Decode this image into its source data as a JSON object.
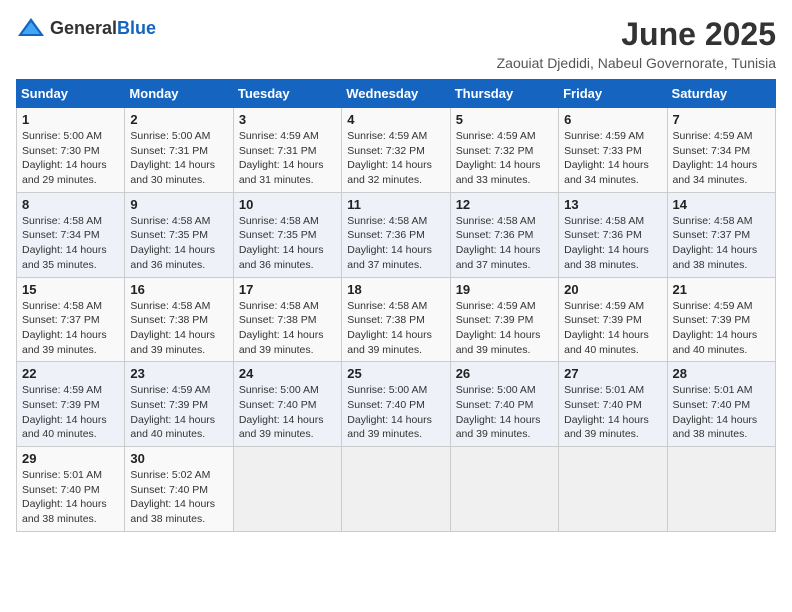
{
  "header": {
    "logo_general": "General",
    "logo_blue": "Blue",
    "month_year": "June 2025",
    "location": "Zaouiat Djedidi, Nabeul Governorate, Tunisia"
  },
  "weekdays": [
    "Sunday",
    "Monday",
    "Tuesday",
    "Wednesday",
    "Thursday",
    "Friday",
    "Saturday"
  ],
  "weeks": [
    [
      {
        "day": "1",
        "sunrise": "5:00 AM",
        "sunset": "7:30 PM",
        "daylight": "14 hours and 29 minutes."
      },
      {
        "day": "2",
        "sunrise": "5:00 AM",
        "sunset": "7:31 PM",
        "daylight": "14 hours and 30 minutes."
      },
      {
        "day": "3",
        "sunrise": "4:59 AM",
        "sunset": "7:31 PM",
        "daylight": "14 hours and 31 minutes."
      },
      {
        "day": "4",
        "sunrise": "4:59 AM",
        "sunset": "7:32 PM",
        "daylight": "14 hours and 32 minutes."
      },
      {
        "day": "5",
        "sunrise": "4:59 AM",
        "sunset": "7:32 PM",
        "daylight": "14 hours and 33 minutes."
      },
      {
        "day": "6",
        "sunrise": "4:59 AM",
        "sunset": "7:33 PM",
        "daylight": "14 hours and 34 minutes."
      },
      {
        "day": "7",
        "sunrise": "4:59 AM",
        "sunset": "7:34 PM",
        "daylight": "14 hours and 34 minutes."
      }
    ],
    [
      {
        "day": "8",
        "sunrise": "4:58 AM",
        "sunset": "7:34 PM",
        "daylight": "14 hours and 35 minutes."
      },
      {
        "day": "9",
        "sunrise": "4:58 AM",
        "sunset": "7:35 PM",
        "daylight": "14 hours and 36 minutes."
      },
      {
        "day": "10",
        "sunrise": "4:58 AM",
        "sunset": "7:35 PM",
        "daylight": "14 hours and 36 minutes."
      },
      {
        "day": "11",
        "sunrise": "4:58 AM",
        "sunset": "7:36 PM",
        "daylight": "14 hours and 37 minutes."
      },
      {
        "day": "12",
        "sunrise": "4:58 AM",
        "sunset": "7:36 PM",
        "daylight": "14 hours and 37 minutes."
      },
      {
        "day": "13",
        "sunrise": "4:58 AM",
        "sunset": "7:36 PM",
        "daylight": "14 hours and 38 minutes."
      },
      {
        "day": "14",
        "sunrise": "4:58 AM",
        "sunset": "7:37 PM",
        "daylight": "14 hours and 38 minutes."
      }
    ],
    [
      {
        "day": "15",
        "sunrise": "4:58 AM",
        "sunset": "7:37 PM",
        "daylight": "14 hours and 39 minutes."
      },
      {
        "day": "16",
        "sunrise": "4:58 AM",
        "sunset": "7:38 PM",
        "daylight": "14 hours and 39 minutes."
      },
      {
        "day": "17",
        "sunrise": "4:58 AM",
        "sunset": "7:38 PM",
        "daylight": "14 hours and 39 minutes."
      },
      {
        "day": "18",
        "sunrise": "4:58 AM",
        "sunset": "7:38 PM",
        "daylight": "14 hours and 39 minutes."
      },
      {
        "day": "19",
        "sunrise": "4:59 AM",
        "sunset": "7:39 PM",
        "daylight": "14 hours and 39 minutes."
      },
      {
        "day": "20",
        "sunrise": "4:59 AM",
        "sunset": "7:39 PM",
        "daylight": "14 hours and 40 minutes."
      },
      {
        "day": "21",
        "sunrise": "4:59 AM",
        "sunset": "7:39 PM",
        "daylight": "14 hours and 40 minutes."
      }
    ],
    [
      {
        "day": "22",
        "sunrise": "4:59 AM",
        "sunset": "7:39 PM",
        "daylight": "14 hours and 40 minutes."
      },
      {
        "day": "23",
        "sunrise": "4:59 AM",
        "sunset": "7:39 PM",
        "daylight": "14 hours and 40 minutes."
      },
      {
        "day": "24",
        "sunrise": "5:00 AM",
        "sunset": "7:40 PM",
        "daylight": "14 hours and 39 minutes."
      },
      {
        "day": "25",
        "sunrise": "5:00 AM",
        "sunset": "7:40 PM",
        "daylight": "14 hours and 39 minutes."
      },
      {
        "day": "26",
        "sunrise": "5:00 AM",
        "sunset": "7:40 PM",
        "daylight": "14 hours and 39 minutes."
      },
      {
        "day": "27",
        "sunrise": "5:01 AM",
        "sunset": "7:40 PM",
        "daylight": "14 hours and 39 minutes."
      },
      {
        "day": "28",
        "sunrise": "5:01 AM",
        "sunset": "7:40 PM",
        "daylight": "14 hours and 38 minutes."
      }
    ],
    [
      {
        "day": "29",
        "sunrise": "5:01 AM",
        "sunset": "7:40 PM",
        "daylight": "14 hours and 38 minutes."
      },
      {
        "day": "30",
        "sunrise": "5:02 AM",
        "sunset": "7:40 PM",
        "daylight": "14 hours and 38 minutes."
      },
      null,
      null,
      null,
      null,
      null
    ]
  ]
}
